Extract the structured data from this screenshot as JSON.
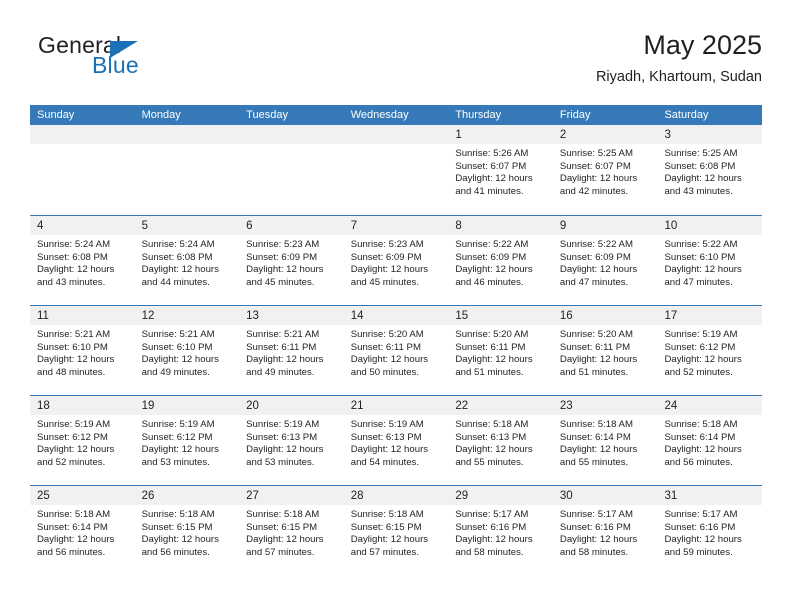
{
  "brand": {
    "name_top": "General",
    "name_bottom": "Blue",
    "accent_color": "#1b71b8"
  },
  "header": {
    "title": "May 2025",
    "subtitle": "Riyadh, Khartoum, Sudan"
  },
  "calendar": {
    "header_bg": "#3579b8",
    "daynum_band_bg": "#f1f1f1",
    "weekdays": [
      "Sunday",
      "Monday",
      "Tuesday",
      "Wednesday",
      "Thursday",
      "Friday",
      "Saturday"
    ],
    "weeks": [
      [
        {
          "day": "",
          "sunrise": "",
          "sunset": "",
          "daylight_1": "",
          "daylight_2": ""
        },
        {
          "day": "",
          "sunrise": "",
          "sunset": "",
          "daylight_1": "",
          "daylight_2": ""
        },
        {
          "day": "",
          "sunrise": "",
          "sunset": "",
          "daylight_1": "",
          "daylight_2": ""
        },
        {
          "day": "",
          "sunrise": "",
          "sunset": "",
          "daylight_1": "",
          "daylight_2": ""
        },
        {
          "day": "1",
          "sunrise": "Sunrise: 5:26 AM",
          "sunset": "Sunset: 6:07 PM",
          "daylight_1": "Daylight: 12 hours",
          "daylight_2": "and 41 minutes."
        },
        {
          "day": "2",
          "sunrise": "Sunrise: 5:25 AM",
          "sunset": "Sunset: 6:07 PM",
          "daylight_1": "Daylight: 12 hours",
          "daylight_2": "and 42 minutes."
        },
        {
          "day": "3",
          "sunrise": "Sunrise: 5:25 AM",
          "sunset": "Sunset: 6:08 PM",
          "daylight_1": "Daylight: 12 hours",
          "daylight_2": "and 43 minutes."
        }
      ],
      [
        {
          "day": "4",
          "sunrise": "Sunrise: 5:24 AM",
          "sunset": "Sunset: 6:08 PM",
          "daylight_1": "Daylight: 12 hours",
          "daylight_2": "and 43 minutes."
        },
        {
          "day": "5",
          "sunrise": "Sunrise: 5:24 AM",
          "sunset": "Sunset: 6:08 PM",
          "daylight_1": "Daylight: 12 hours",
          "daylight_2": "and 44 minutes."
        },
        {
          "day": "6",
          "sunrise": "Sunrise: 5:23 AM",
          "sunset": "Sunset: 6:09 PM",
          "daylight_1": "Daylight: 12 hours",
          "daylight_2": "and 45 minutes."
        },
        {
          "day": "7",
          "sunrise": "Sunrise: 5:23 AM",
          "sunset": "Sunset: 6:09 PM",
          "daylight_1": "Daylight: 12 hours",
          "daylight_2": "and 45 minutes."
        },
        {
          "day": "8",
          "sunrise": "Sunrise: 5:22 AM",
          "sunset": "Sunset: 6:09 PM",
          "daylight_1": "Daylight: 12 hours",
          "daylight_2": "and 46 minutes."
        },
        {
          "day": "9",
          "sunrise": "Sunrise: 5:22 AM",
          "sunset": "Sunset: 6:09 PM",
          "daylight_1": "Daylight: 12 hours",
          "daylight_2": "and 47 minutes."
        },
        {
          "day": "10",
          "sunrise": "Sunrise: 5:22 AM",
          "sunset": "Sunset: 6:10 PM",
          "daylight_1": "Daylight: 12 hours",
          "daylight_2": "and 47 minutes."
        }
      ],
      [
        {
          "day": "11",
          "sunrise": "Sunrise: 5:21 AM",
          "sunset": "Sunset: 6:10 PM",
          "daylight_1": "Daylight: 12 hours",
          "daylight_2": "and 48 minutes."
        },
        {
          "day": "12",
          "sunrise": "Sunrise: 5:21 AM",
          "sunset": "Sunset: 6:10 PM",
          "daylight_1": "Daylight: 12 hours",
          "daylight_2": "and 49 minutes."
        },
        {
          "day": "13",
          "sunrise": "Sunrise: 5:21 AM",
          "sunset": "Sunset: 6:11 PM",
          "daylight_1": "Daylight: 12 hours",
          "daylight_2": "and 49 minutes."
        },
        {
          "day": "14",
          "sunrise": "Sunrise: 5:20 AM",
          "sunset": "Sunset: 6:11 PM",
          "daylight_1": "Daylight: 12 hours",
          "daylight_2": "and 50 minutes."
        },
        {
          "day": "15",
          "sunrise": "Sunrise: 5:20 AM",
          "sunset": "Sunset: 6:11 PM",
          "daylight_1": "Daylight: 12 hours",
          "daylight_2": "and 51 minutes."
        },
        {
          "day": "16",
          "sunrise": "Sunrise: 5:20 AM",
          "sunset": "Sunset: 6:11 PM",
          "daylight_1": "Daylight: 12 hours",
          "daylight_2": "and 51 minutes."
        },
        {
          "day": "17",
          "sunrise": "Sunrise: 5:19 AM",
          "sunset": "Sunset: 6:12 PM",
          "daylight_1": "Daylight: 12 hours",
          "daylight_2": "and 52 minutes."
        }
      ],
      [
        {
          "day": "18",
          "sunrise": "Sunrise: 5:19 AM",
          "sunset": "Sunset: 6:12 PM",
          "daylight_1": "Daylight: 12 hours",
          "daylight_2": "and 52 minutes."
        },
        {
          "day": "19",
          "sunrise": "Sunrise: 5:19 AM",
          "sunset": "Sunset: 6:12 PM",
          "daylight_1": "Daylight: 12 hours",
          "daylight_2": "and 53 minutes."
        },
        {
          "day": "20",
          "sunrise": "Sunrise: 5:19 AM",
          "sunset": "Sunset: 6:13 PM",
          "daylight_1": "Daylight: 12 hours",
          "daylight_2": "and 53 minutes."
        },
        {
          "day": "21",
          "sunrise": "Sunrise: 5:19 AM",
          "sunset": "Sunset: 6:13 PM",
          "daylight_1": "Daylight: 12 hours",
          "daylight_2": "and 54 minutes."
        },
        {
          "day": "22",
          "sunrise": "Sunrise: 5:18 AM",
          "sunset": "Sunset: 6:13 PM",
          "daylight_1": "Daylight: 12 hours",
          "daylight_2": "and 55 minutes."
        },
        {
          "day": "23",
          "sunrise": "Sunrise: 5:18 AM",
          "sunset": "Sunset: 6:14 PM",
          "daylight_1": "Daylight: 12 hours",
          "daylight_2": "and 55 minutes."
        },
        {
          "day": "24",
          "sunrise": "Sunrise: 5:18 AM",
          "sunset": "Sunset: 6:14 PM",
          "daylight_1": "Daylight: 12 hours",
          "daylight_2": "and 56 minutes."
        }
      ],
      [
        {
          "day": "25",
          "sunrise": "Sunrise: 5:18 AM",
          "sunset": "Sunset: 6:14 PM",
          "daylight_1": "Daylight: 12 hours",
          "daylight_2": "and 56 minutes."
        },
        {
          "day": "26",
          "sunrise": "Sunrise: 5:18 AM",
          "sunset": "Sunset: 6:15 PM",
          "daylight_1": "Daylight: 12 hours",
          "daylight_2": "and 56 minutes."
        },
        {
          "day": "27",
          "sunrise": "Sunrise: 5:18 AM",
          "sunset": "Sunset: 6:15 PM",
          "daylight_1": "Daylight: 12 hours",
          "daylight_2": "and 57 minutes."
        },
        {
          "day": "28",
          "sunrise": "Sunrise: 5:18 AM",
          "sunset": "Sunset: 6:15 PM",
          "daylight_1": "Daylight: 12 hours",
          "daylight_2": "and 57 minutes."
        },
        {
          "day": "29",
          "sunrise": "Sunrise: 5:17 AM",
          "sunset": "Sunset: 6:16 PM",
          "daylight_1": "Daylight: 12 hours",
          "daylight_2": "and 58 minutes."
        },
        {
          "day": "30",
          "sunrise": "Sunrise: 5:17 AM",
          "sunset": "Sunset: 6:16 PM",
          "daylight_1": "Daylight: 12 hours",
          "daylight_2": "and 58 minutes."
        },
        {
          "day": "31",
          "sunrise": "Sunrise: 5:17 AM",
          "sunset": "Sunset: 6:16 PM",
          "daylight_1": "Daylight: 12 hours",
          "daylight_2": "and 59 minutes."
        }
      ]
    ]
  }
}
